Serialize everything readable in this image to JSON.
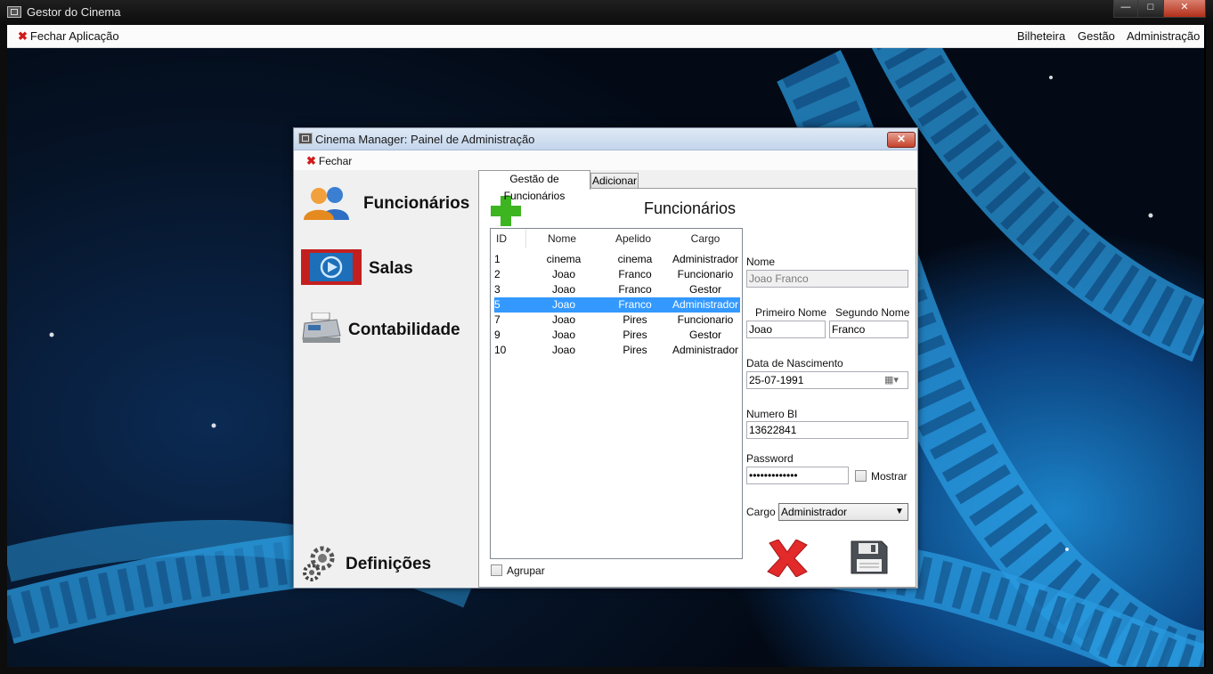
{
  "window": {
    "title": "Gestor do Cinema",
    "min": "—",
    "max": "□",
    "close": "✕"
  },
  "menubar": {
    "close_app": "Fechar Aplicação",
    "items": [
      "Bilheteira",
      "Gestão",
      "Administração"
    ]
  },
  "dialog": {
    "title": "Cinema Manager: Painel de Administração",
    "close_glyph": "✕",
    "menu_close": "Fechar",
    "nav": {
      "funcionarios": "Funcionários",
      "salas": "Salas",
      "contabilidade": "Contabilidade",
      "definicoes": "Definições"
    },
    "tabs": [
      "Gestão de Funcionários",
      "Adicionar"
    ],
    "heading": "Funcionários",
    "grid": {
      "headers": [
        "ID",
        "Nome",
        "Apelido",
        "Cargo"
      ],
      "rows": [
        [
          "1",
          "cinema",
          "cinema",
          "Administrador"
        ],
        [
          "2",
          "Joao",
          "Franco",
          "Funcionario"
        ],
        [
          "3",
          "Joao",
          "Franco",
          "Gestor"
        ],
        [
          "5",
          "Joao",
          "Franco",
          "Administrador"
        ],
        [
          "7",
          "Joao",
          "Pires",
          "Funcionario"
        ],
        [
          "9",
          "Joao",
          "Pires",
          "Gestor"
        ],
        [
          "10",
          "Joao",
          "Pires",
          "Administrador"
        ]
      ],
      "selected_index": 3
    },
    "group_label": "Agrupar",
    "form": {
      "nome_label": "Nome",
      "nome_value": "Joao Franco",
      "primeiro_label": "Primeiro Nome",
      "primeiro_value": "Joao",
      "segundo_label": "Segundo Nome",
      "segundo_value": "Franco",
      "nascimento_label": "Data de Nascimento",
      "nascimento_value": "25-07-1991",
      "bi_label": "Numero BI",
      "bi_value": "13622841",
      "password_label": "Password",
      "password_value": "•••••••••••••",
      "mostrar_label": "Mostrar",
      "cargo_label": "Cargo",
      "cargo_value": "Administrador"
    }
  },
  "colors": {
    "selection": "#3399ff",
    "accent_red": "#d11a1a",
    "desktop_blue": "#1c83c9"
  }
}
